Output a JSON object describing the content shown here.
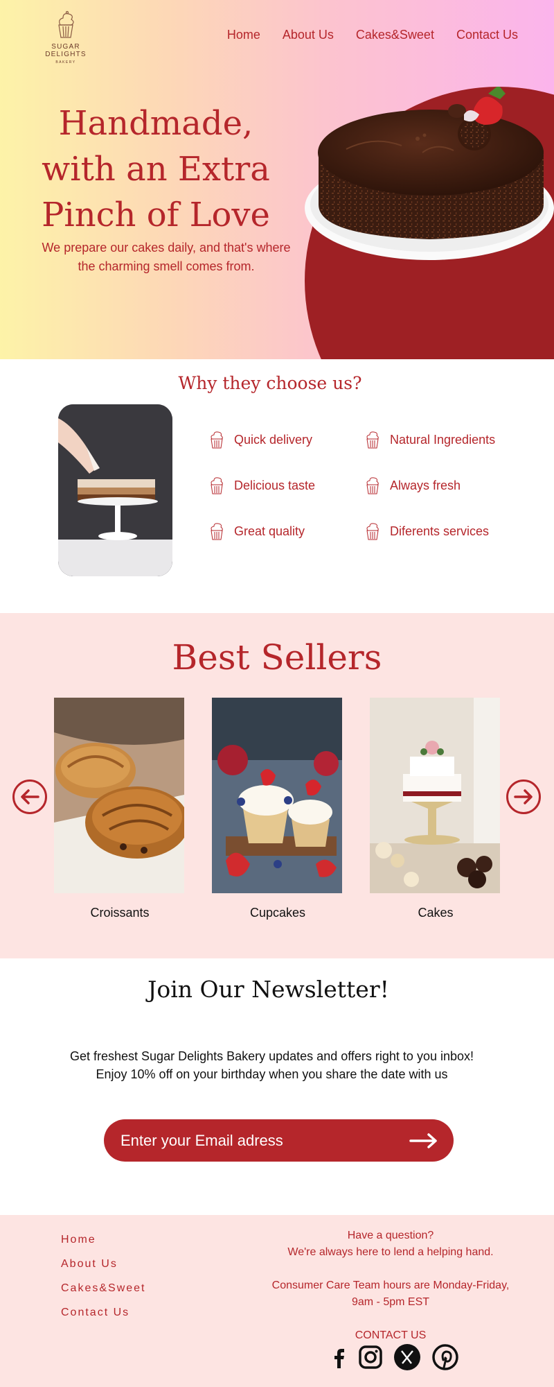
{
  "brand": {
    "name": "SUGAR DELIGHTS",
    "tagline": "BAKERY"
  },
  "nav": {
    "items": [
      "Home",
      "About Us",
      "Cakes&Sweet",
      "Contact Us"
    ]
  },
  "hero": {
    "title_lines": [
      "Handmade,",
      "with an Extra",
      "Pinch of Love"
    ],
    "subtitle": "We prepare our cakes daily, and that's where the charming smell comes from."
  },
  "why": {
    "title": "Why they choose us?",
    "features": [
      "Quick delivery",
      "Natural Ingredients",
      "Delicious taste",
      "Always fresh",
      "Great quality",
      "Diferents services"
    ],
    "icon": "cupcake-icon"
  },
  "best_sellers": {
    "title": "Best Sellers",
    "products": [
      "Croissants",
      "Cupcakes",
      "Cakes"
    ],
    "prev_icon": "arrow-left-icon",
    "next_icon": "arrow-right-icon"
  },
  "newsletter": {
    "title": "Join Our Newsletter!",
    "text_line1": "Get freshest Sugar Delights Bakery updates and offers right to you inbox!",
    "text_line2": "Enjoy 10% off on your birthday when you share the date with us",
    "email_placeholder": "Enter your Email adress",
    "submit_icon": "arrow-right-icon"
  },
  "footer": {
    "links": [
      "Home",
      "About Us",
      "Cakes&Sweet",
      "Contact Us"
    ],
    "question": "Have a question?",
    "help": "We're always here to lend a helping hand.",
    "hours": "Consumer Care Team hours are Monday-Friday, 9am - 5pm EST",
    "contact_label": "CONTACT US",
    "socials": [
      "facebook-icon",
      "instagram-icon",
      "x-icon",
      "pinterest-icon"
    ]
  },
  "colors": {
    "brand_red": "#b5262b",
    "dark_red": "#9e2024",
    "pink_bg": "#fde4e2"
  }
}
